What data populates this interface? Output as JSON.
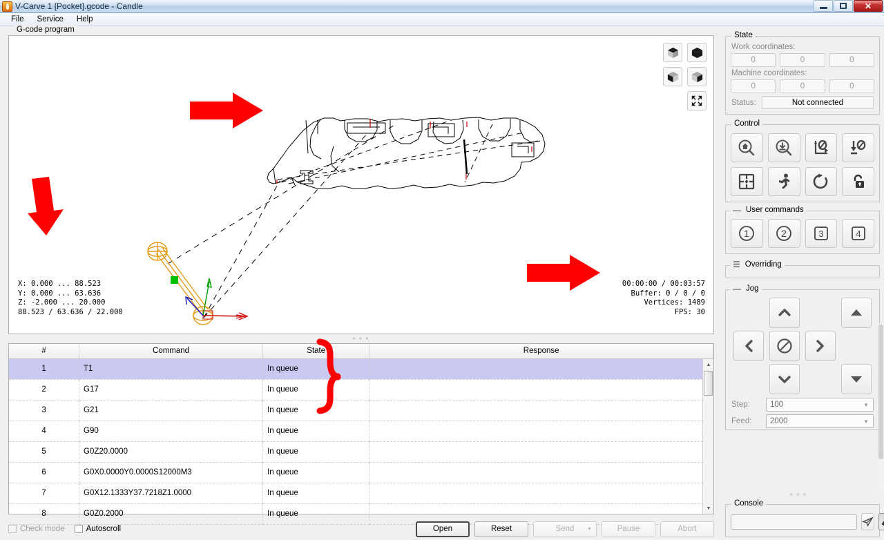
{
  "window": {
    "title": "V-Carve 1 [Pocket].gcode - Candle",
    "app_icon": "flame-icon",
    "minimize_label": "",
    "maximize_label": "",
    "close_label": "✕"
  },
  "menu": {
    "items": [
      {
        "label": "File"
      },
      {
        "label": "Service"
      },
      {
        "label": "Help"
      }
    ]
  },
  "gcode_panel": {
    "title": "G-code program",
    "viewport": {
      "info_left": "X: 0.000 ... 88.523\nY: 0.000 ... 63.636\nZ: -2.000 ... 20.000\n88.523 / 63.636 / 22.000",
      "info_right": "00:00:00 / 00:03:57\nBuffer: 0 / 0 / 0\nVertices: 1489\nFPS: 30",
      "x_range": "0.000 ... 88.523",
      "y_range": "0.000 ... 63.636",
      "z_range": "-2.000 ... 20.000",
      "dimensions": "88.523 / 63.636 / 22.000",
      "elapsed": "00:00:00",
      "total_time": "00:03:57",
      "buffer": "0 / 0 / 0",
      "vertices": "1489",
      "fps": "30",
      "buttons": [
        {
          "name": "isometric-view-button",
          "icon": "cube-top-icon"
        },
        {
          "name": "front-view-button",
          "icon": "cube-front-icon"
        },
        {
          "name": "left-view-button",
          "icon": "cube-left-icon"
        },
        {
          "name": "top-view-button",
          "icon": "cube-iso-icon"
        },
        {
          "name": "fit-view-button",
          "icon": "fit-screen-icon"
        }
      ]
    }
  },
  "table": {
    "columns": [
      "#",
      "Command",
      "State",
      "Response"
    ],
    "rows": [
      {
        "n": "1",
        "command": "T1",
        "state": "In queue",
        "response": "",
        "selected": true
      },
      {
        "n": "2",
        "command": "G17",
        "state": "In queue",
        "response": "",
        "selected": false
      },
      {
        "n": "3",
        "command": "G21",
        "state": "In queue",
        "response": "",
        "selected": false
      },
      {
        "n": "4",
        "command": "G90",
        "state": "In queue",
        "response": "",
        "selected": false
      },
      {
        "n": "5",
        "command": "G0Z20.0000",
        "state": "In queue",
        "response": "",
        "selected": false
      },
      {
        "n": "6",
        "command": "G0X0.0000Y0.0000S12000M3",
        "state": "In queue",
        "response": "",
        "selected": false
      },
      {
        "n": "7",
        "command": "G0X12.1333Y37.7218Z1.0000",
        "state": "In queue",
        "response": "",
        "selected": false
      },
      {
        "n": "8",
        "command": "G0Z0.2000",
        "state": "In queue",
        "response": "",
        "selected": false
      }
    ]
  },
  "bottombar": {
    "check_mode_label": "Check mode",
    "autoscroll_label": "Autoscroll",
    "buttons": [
      {
        "label": "Open",
        "state": "focus"
      },
      {
        "label": "Reset",
        "state": "normal"
      },
      {
        "label": "Send",
        "state": "disabled"
      },
      {
        "label": "Pause",
        "state": "disabled"
      },
      {
        "label": "Abort",
        "state": "disabled"
      }
    ]
  },
  "state_panel": {
    "title": "State",
    "work_label": "Work coordinates:",
    "work_values": [
      "0",
      "0",
      "0"
    ],
    "machine_label": "Machine coordinates:",
    "machine_values": [
      "0",
      "0",
      "0"
    ],
    "status_label": "Status:",
    "status_value": "Not connected"
  },
  "control_panel": {
    "title": "Control",
    "buttons": [
      {
        "name": "home-button",
        "icon": "home-search-icon"
      },
      {
        "name": "probe-button",
        "icon": "down-search-icon"
      },
      {
        "name": "zero-xy-button",
        "icon": "xy-zero-icon"
      },
      {
        "name": "zero-z-button",
        "icon": "z-zero-icon"
      },
      {
        "name": "safe-position-button",
        "icon": "center-target-icon"
      },
      {
        "name": "run-button",
        "icon": "runner-icon"
      },
      {
        "name": "reset-button",
        "icon": "refresh-icon"
      },
      {
        "name": "unlock-button",
        "icon": "unlock-icon"
      }
    ]
  },
  "user_commands_panel": {
    "title": "User commands",
    "collapse_mark": "—",
    "buttons": [
      {
        "name": "user-command-1-button",
        "label": "1",
        "shape": "circle"
      },
      {
        "name": "user-command-2-button",
        "label": "2",
        "shape": "circle"
      },
      {
        "name": "user-command-3-button",
        "label": "3",
        "shape": "square"
      },
      {
        "name": "user-command-4-button",
        "label": "4",
        "shape": "square"
      }
    ]
  },
  "overriding_panel": {
    "title": "Overriding",
    "collapse_mark": "☰"
  },
  "jog_panel": {
    "title": "Jog",
    "collapse_mark": "—",
    "buttons": [
      {
        "name": "jog-y-plus-button",
        "icon": "chevron-up-icon"
      },
      {
        "name": "jog-z-plus-button",
        "icon": "triangle-up-icon"
      },
      {
        "name": "jog-x-minus-button",
        "icon": "chevron-left-icon"
      },
      {
        "name": "jog-stop-button",
        "icon": "no-entry-icon"
      },
      {
        "name": "jog-x-plus-button",
        "icon": "chevron-right-icon"
      },
      {
        "name": "jog-y-minus-button",
        "icon": "chevron-down-icon"
      },
      {
        "name": "jog-z-minus-button",
        "icon": "triangle-down-icon"
      }
    ],
    "step_label": "Step:",
    "step_value": "100",
    "feed_label": "Feed:",
    "feed_value": "2000"
  },
  "console_panel": {
    "title": "Console",
    "input_value": "",
    "send_icon": "paper-plane-icon",
    "clear_icon": "eraser-icon"
  },
  "annotations": {
    "arrows": [
      {
        "name": "annotation-arrow-model",
        "direction": "right"
      },
      {
        "name": "annotation-arrow-info",
        "direction": "down"
      },
      {
        "name": "annotation-arrow-stats",
        "direction": "right"
      },
      {
        "name": "annotation-brace-state",
        "direction": "brace"
      }
    ],
    "color": "#ff0000"
  }
}
